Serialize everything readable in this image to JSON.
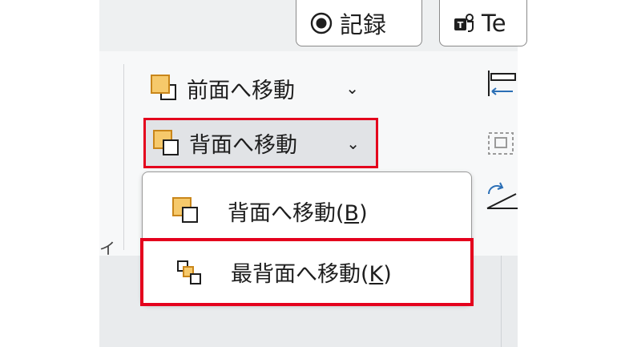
{
  "toolbar": {
    "record_label": "記録",
    "teams_label": "Te"
  },
  "ribbon": {
    "bring_forward_label": "前面へ移動",
    "send_backward_label": "背面へ移動",
    "left_partial_glyph": "イ"
  },
  "dropdown": {
    "send_backward": {
      "prefix": "背面へ移動(",
      "accel": "B",
      "suffix": ")"
    },
    "send_to_back": {
      "prefix": "最背面へ移動(",
      "accel": "K",
      "suffix": ")"
    }
  },
  "colors": {
    "highlight_red": "#e4001d",
    "shape_orange": "#f6c96b",
    "icon_blue": "#2b6fb6"
  },
  "icons": [
    "record-icon",
    "teams-icon",
    "bring-forward-icon",
    "send-backward-icon",
    "send-to-back-icon",
    "align-icon",
    "group-icon",
    "rotate-icon",
    "chevron-down-icon"
  ]
}
